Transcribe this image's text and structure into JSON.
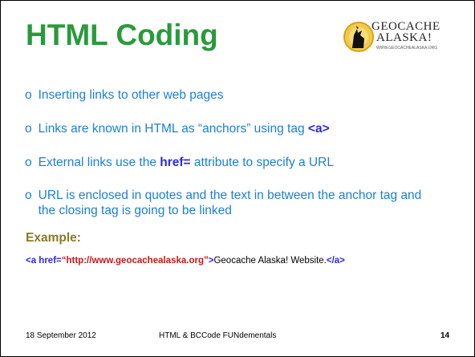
{
  "slide": {
    "title": "HTML Coding",
    "logo": {
      "line1": "GEOCACHE",
      "line2": "ALASKA!",
      "url": "WWW.GEOCACHEALASKA.ORG"
    },
    "bullet_mark": "o",
    "bullets": [
      {
        "text": "Inserting links to other web pages"
      },
      {
        "text": "Links are known in HTML as “anchors” using tag ",
        "keyword": "<a>"
      },
      {
        "text_before": "External links use the ",
        "keyword": "href=",
        "text_after": " attribute to specify a URL"
      },
      {
        "text": "URL is enclosed in quotes and the text in between the anchor tag and the closing tag is going to be linked"
      }
    ],
    "example_label": "Example:",
    "example": {
      "open_tag_start": "<a href=",
      "url": "“http://www.geocachealaska.org”",
      "open_tag_end": ">",
      "link_text": "Geocache Alaska! Website.",
      "close_tag": "</a>"
    },
    "footer": {
      "date": "18 September 2012",
      "title": "HTML & BCCode FUNdementals",
      "page": "14"
    }
  },
  "colors": {
    "title": "#2a9a3c",
    "bullet_text": "#1b7fd6",
    "keyword": "#2b2bdf",
    "example_label": "#8a7a23",
    "url": "#c01a1a"
  }
}
